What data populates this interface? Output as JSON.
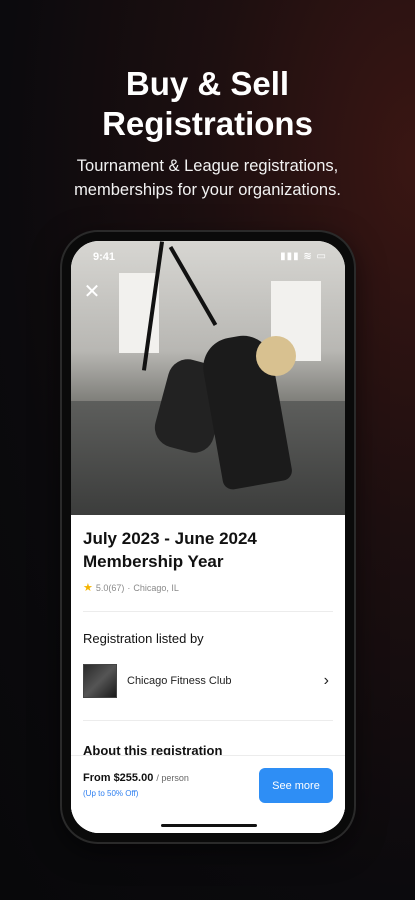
{
  "promo": {
    "headline_line1": "Buy & Sell",
    "headline_line2": "Registrations",
    "subline_line1": "Tournament & League registrations,",
    "subline_line2": "memberships for your organizations."
  },
  "status_bar": {
    "time": "9:41"
  },
  "listing": {
    "title_line1": "July 2023 - June 2024",
    "title_line2": "Membership Year",
    "rating": "5.0(67)",
    "separator": "·",
    "location": "Chicago, IL"
  },
  "registration": {
    "section_title": "Registration listed by",
    "org_name": "Chicago Fitness Club"
  },
  "about": {
    "title": "About this registration"
  },
  "purchase": {
    "price_prefix": "From",
    "price": "$255.00",
    "unit": "/ person",
    "discount": "(Up to 50% Off)",
    "cta": "See more"
  },
  "icons": {
    "close": "close-icon",
    "star": "star-icon",
    "chevron": "chevron-right-icon",
    "signal": "signal-icon",
    "wifi": "wifi-icon",
    "battery": "battery-icon"
  },
  "colors": {
    "accent": "#2e8ef5",
    "discount": "#2e7ff0",
    "star": "#f5b400"
  }
}
